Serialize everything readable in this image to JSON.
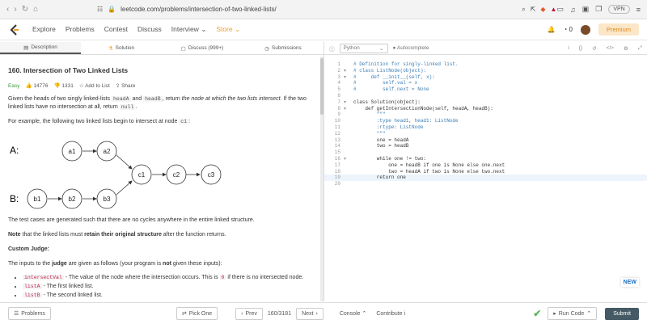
{
  "browser": {
    "url": "leetcode.com/problems/intersection-of-two-linked-lists/",
    "vpn": "VPN"
  },
  "nav": {
    "items": [
      "Explore",
      "Problems",
      "Contest",
      "Discuss",
      "Interview"
    ],
    "store": "Store",
    "notif_count": "0",
    "premium": "Premium"
  },
  "tabs": {
    "description": "Description",
    "solution": "Solution",
    "discuss": "Discuss (999+)",
    "submissions": "Submissions"
  },
  "problem": {
    "title": "160. Intersection of Two Linked Lists",
    "difficulty": "Easy",
    "likes": "14776",
    "dislikes": "1331",
    "add_to_list": "Add to List",
    "share": "Share",
    "p1a": "Given the heads of two singly linked-lists ",
    "headA": "headA",
    "p1b": " and ",
    "headB": "headB",
    "p1c": ", return ",
    "p1d": "the node at which the two lists intersect",
    "p1e": ". If the two linked lists have no intersection at all, return ",
    "null": "null",
    "p1f": ".",
    "p2a": "For example, the following two linked lists begin to intersect at node ",
    "c1": "c1",
    "p2b": ":",
    "p3": "The test cases are generated such that there are no cycles anywhere in the entire linked structure.",
    "p4a": "Note",
    "p4b": " that the linked lists must ",
    "p4c": "retain their original structure",
    "p4d": " after the function returns.",
    "judge_title": "Custom Judge:",
    "p5a": "The inputs to the ",
    "p5b": "judge",
    "p5c": " are given as follows (your program is ",
    "p5d": "not",
    "p5e": " given these inputs):",
    "li1a": "intersectVal",
    "li1b": " - The value of the node where the intersection occurs. This is ",
    "li1c": "0",
    "li1d": " if there is no intersected node.",
    "li2a": "listA",
    "li2b": " - The first linked list.",
    "li3a": "listB",
    "li3b": " - The second linked list."
  },
  "diagram": {
    "labelA": "A:",
    "labelB": "B:",
    "a1": "a1",
    "a2": "a2",
    "b1": "b1",
    "b2": "b2",
    "b3": "b3",
    "c1": "c1",
    "c2": "c2",
    "c3": "c3"
  },
  "editor": {
    "lang": "Python",
    "autocomplete": "Autocomplete"
  },
  "code_lines": [
    {
      "n": "1",
      "t": "# Definition for singly-linked list."
    },
    {
      "n": "2",
      "t": "# class ListNode(object):"
    },
    {
      "n": "3",
      "t": "#     def __init__(self, x):"
    },
    {
      "n": "4",
      "t": "#         self.val = x"
    },
    {
      "n": "5",
      "t": "#         self.next = None"
    },
    {
      "n": "6",
      "t": ""
    },
    {
      "n": "7",
      "t": "class Solution(object):"
    },
    {
      "n": "8",
      "t": "    def getIntersectionNode(self, headA, headB):"
    },
    {
      "n": "9",
      "t": "        \"\"\""
    },
    {
      "n": "10",
      "t": "        :type head1, head1: ListNode"
    },
    {
      "n": "11",
      "t": "        :rtype: ListNode"
    },
    {
      "n": "12",
      "t": "        \"\"\""
    },
    {
      "n": "13",
      "t": "        one = headA"
    },
    {
      "n": "14",
      "t": "        two = headB"
    },
    {
      "n": "15",
      "t": ""
    },
    {
      "n": "16",
      "t": "        while one != two:"
    },
    {
      "n": "17",
      "t": "            one = headB if one is None else one.next"
    },
    {
      "n": "18",
      "t": "            two = headA if two is None else two.next"
    },
    {
      "n": "19",
      "t": "        return one"
    },
    {
      "n": "20",
      "t": ""
    }
  ],
  "bottom": {
    "problems": "Problems",
    "pick_one": "Pick One",
    "prev": "Prev",
    "page": "160/3181",
    "next": "Next",
    "console": "Console",
    "contribute": "Contribute",
    "run": "Run Code",
    "submit": "Submit"
  },
  "new_badge": "NEW"
}
